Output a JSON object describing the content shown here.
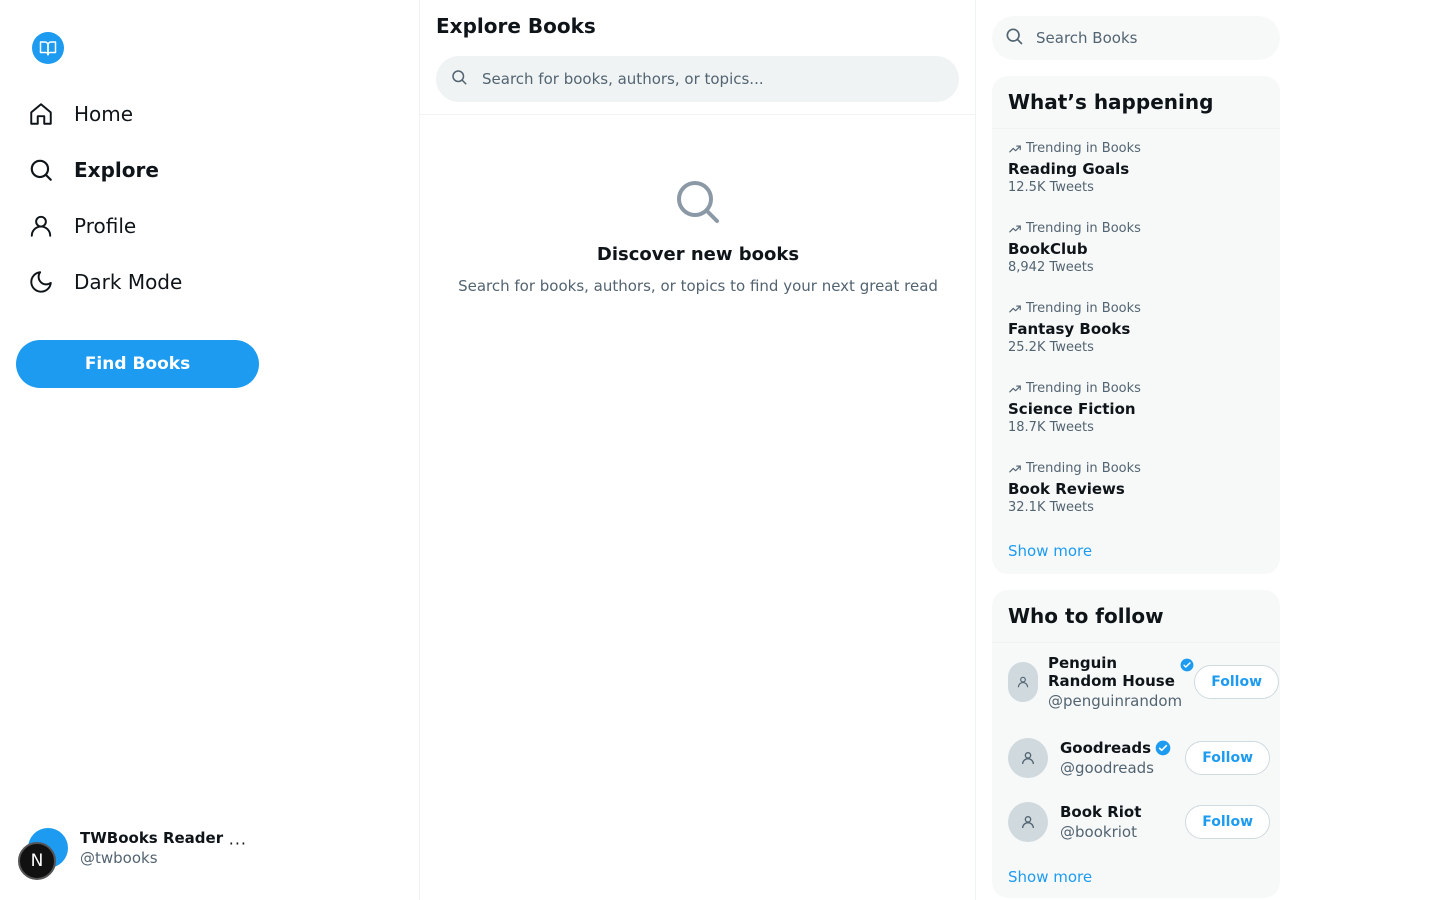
{
  "app": {
    "brand_color": "#1d9bf0",
    "logo_icon": "book-open-icon"
  },
  "sidebar": {
    "items": [
      {
        "label": "Home",
        "icon": "home-icon",
        "active": false
      },
      {
        "label": "Explore",
        "icon": "search-icon",
        "active": true
      },
      {
        "label": "Profile",
        "icon": "user-icon",
        "active": false
      },
      {
        "label": "Dark Mode",
        "icon": "moon-icon",
        "active": false
      }
    ],
    "cta_label": "Find Books",
    "account": {
      "name": "TWBooks Reader",
      "handle": "@twbooks",
      "more": "···",
      "badge": "N"
    }
  },
  "main": {
    "title": "Explore Books",
    "search_placeholder": "Search for books, authors, or topics...",
    "empty_title": "Discover new books",
    "empty_subtitle": "Search for books, authors, or topics to find your next great read"
  },
  "right": {
    "search_placeholder": "Search Books",
    "trends": {
      "title": "What’s happening",
      "items": [
        {
          "meta": "Trending in Books",
          "name": "Reading Goals",
          "count": "12.5K Tweets"
        },
        {
          "meta": "Trending in Books",
          "name": "BookClub",
          "count": "8,942 Tweets"
        },
        {
          "meta": "Trending in Books",
          "name": "Fantasy Books",
          "count": "25.2K Tweets"
        },
        {
          "meta": "Trending in Books",
          "name": "Science Fiction",
          "count": "18.7K Tweets"
        },
        {
          "meta": "Trending in Books",
          "name": "Book Reviews",
          "count": "32.1K Tweets"
        }
      ],
      "show_more": "Show more"
    },
    "follow": {
      "title": "Who to follow",
      "items": [
        {
          "name": "Penguin Random House",
          "handle": "@penguinrandom",
          "verified": true,
          "button": "Follow"
        },
        {
          "name": "Goodreads",
          "handle": "@goodreads",
          "verified": true,
          "button": "Follow"
        },
        {
          "name": "Book Riot",
          "handle": "@bookriot",
          "verified": false,
          "button": "Follow"
        }
      ],
      "show_more": "Show more"
    }
  }
}
